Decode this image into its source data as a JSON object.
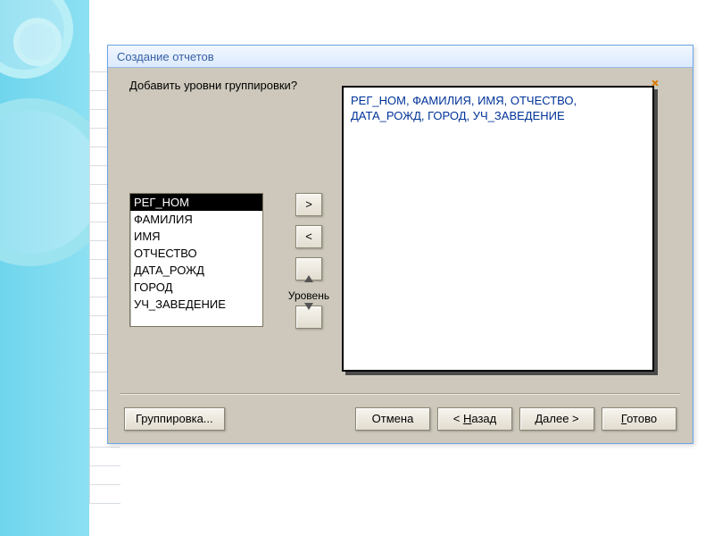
{
  "window": {
    "title": "Создание отчетов"
  },
  "prompt": "Добавить уровни группировки?",
  "fields": [
    "РЕГ_НОМ",
    "ФАМИЛИЯ",
    "ИМЯ",
    "ОТЧЕСТВО",
    "ДАТА_РОЖД",
    "ГОРОД",
    "УЧ_ЗАВЕДЕНИЕ"
  ],
  "selected_field_index": 0,
  "mid": {
    "add": ">",
    "remove": "<",
    "priority_label": "Уровень"
  },
  "preview_line1": "РЕГ_НОМ, ФАМИЛИЯ, ИМЯ, ОТЧЕСТВО,",
  "preview_line2": "ДАТА_РОЖД, ГОРОД, УЧ_ЗАВЕДЕНИЕ",
  "buttons": {
    "grouping": "Группировка...",
    "cancel": "Отмена",
    "back_pre": "< ",
    "back_u": "Н",
    "back_post": "азад",
    "next_u": "Д",
    "next_post": "алее >",
    "finish_u": "Г",
    "finish_post": "отово"
  }
}
